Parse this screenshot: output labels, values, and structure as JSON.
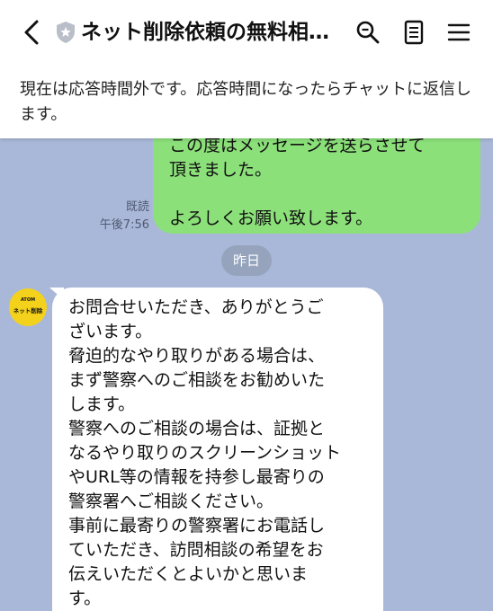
{
  "header": {
    "title": "ネット削除依頼の無料相…",
    "icons": [
      "back-chevron-icon",
      "shield-star-icon",
      "search-icon",
      "note-icon",
      "menu-icon"
    ]
  },
  "notice": {
    "text": "現在は応答時間外です。応答時間になったらチャットに返信します。"
  },
  "messages": {
    "outgoing": {
      "text": "この度はメッセージを送らさせて\n頂きました。\n\nよろしくお願い致します。",
      "read_label": "既読",
      "time": "午後7:56"
    },
    "date_divider": "昨日",
    "incoming": {
      "avatar_line1": "ATOM",
      "avatar_line2": "ネット削除",
      "text": "お問合せいただき、ありがとうご\nざいます。\n脅迫的なやり取りがある場合は、\nまず警察へのご相談をお勧めいた\nします。\n警察へのご相談の場合は、証拠と\nなるやり取りのスクリーンショット\nやURL等の情報を持参し最寄りの\n警察署へご相談ください。\n事前に最寄りの警察署にお電話し\nていただき、訪問相談の希望をお\n伝えいただくとよいかと思いま\nす。"
    }
  },
  "colors": {
    "chat_background": "#a9b8d8",
    "outgoing_bubble": "#8ce07a",
    "incoming_bubble": "#ffffff",
    "avatar": "#f4d21c"
  }
}
